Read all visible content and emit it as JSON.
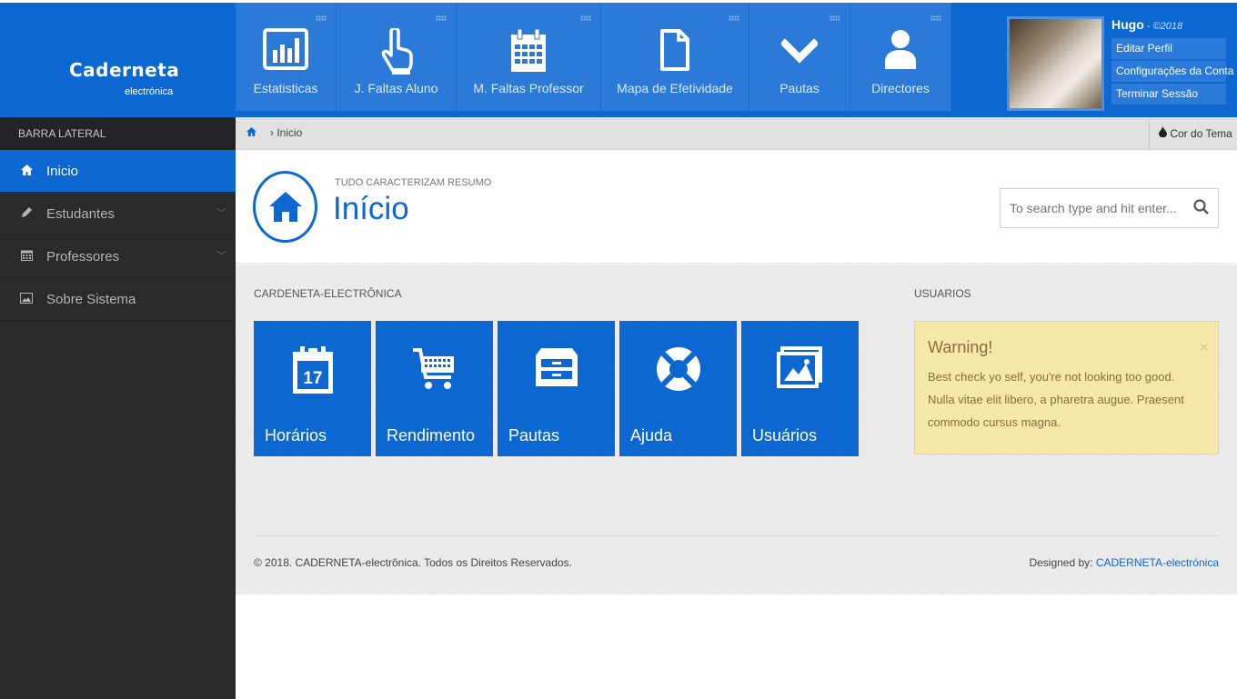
{
  "brand": {
    "name": "Caderneta",
    "sub": "electrónica"
  },
  "topnav": [
    {
      "label": "Estatisticas",
      "icon": "bar-chart-icon"
    },
    {
      "label": "J. Faltas Aluno",
      "icon": "hand-pointer-icon"
    },
    {
      "label": "M. Faltas Professor",
      "icon": "calendar-icon"
    },
    {
      "label": "Mapa de Efetividade",
      "icon": "file-icon"
    },
    {
      "label": "Pautas",
      "icon": "chevron-down-icon"
    },
    {
      "label": "Directores",
      "icon": "user-icon"
    }
  ],
  "profile": {
    "name": "Hugo",
    "year": " - ©2018",
    "menu": [
      "Editar Perfil",
      "Configurações da Conta",
      "Terminar Sessão"
    ]
  },
  "sidebar": {
    "heading": "BARRA LATERAL",
    "items": [
      {
        "label": "Inicio",
        "icon": "home-icon",
        "active": true
      },
      {
        "label": "Estudantes",
        "icon": "pencil-icon",
        "expandable": true
      },
      {
        "label": "Professores",
        "icon": "calendar-icon",
        "expandable": true
      },
      {
        "label": "Sobre Sistema",
        "icon": "image-icon"
      }
    ]
  },
  "breadcrumb": {
    "path": "Inicio",
    "theme": "Cor do Tema"
  },
  "page": {
    "subtitle": "TUDO CARACTERIZAM RESUMO",
    "title": "Início",
    "search_placeholder": "To search type and hit enter..."
  },
  "sections": {
    "left": "CARDENETA-ELECTRÔNICA",
    "right": "USUARIOS"
  },
  "tiles": [
    {
      "label": "Horários",
      "icon": "calendar-17-icon"
    },
    {
      "label": "Rendimento",
      "icon": "shopping-cart-icon"
    },
    {
      "label": "Pautas",
      "icon": "drawer-icon"
    },
    {
      "label": "Ajuda",
      "icon": "life-ring-icon"
    },
    {
      "label": "Usuários",
      "icon": "picture-icon"
    }
  ],
  "warning": {
    "title": "Warning!",
    "body": "Best check yo self, you're not looking too good. Nulla vitae elit libero, a pharetra augue. Praesent commodo cursus magna.",
    "close": "×"
  },
  "footer": {
    "copyright": "© 2018. CADERNETA-electrônica. Todos os Direitos Reservados.",
    "designed_prefix": "Designed by: ",
    "designed_by": "CADERNETA-electrónica"
  },
  "colors": {
    "primary": "#0d67d1",
    "sidebar": "#292a2c",
    "warning_bg": "#f5e8a8"
  }
}
